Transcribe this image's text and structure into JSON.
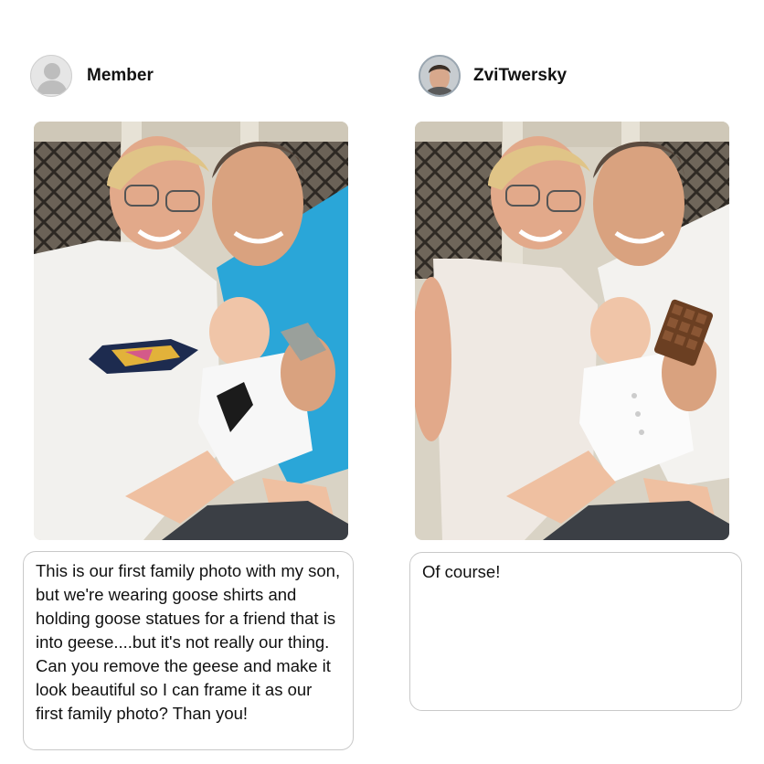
{
  "posts": [
    {
      "username": "Member",
      "avatar_icon": "default-user-icon",
      "message": "This is our first family photo with my son, but we're wearing goose shirts and holding goose statues for a friend that is into geese....but it's not really our thing. Can you remove the geese and make it look beautiful so I can frame it as our first family photo? Than you!"
    },
    {
      "username": "ZviTwersky",
      "avatar_icon": "user-photo-avatar",
      "message": "Of course!"
    }
  ],
  "colors": {
    "shirt_blue": "#2aa6d8",
    "bubble_border": "#c9c9c9",
    "curtain_dark": "#3b3530"
  }
}
